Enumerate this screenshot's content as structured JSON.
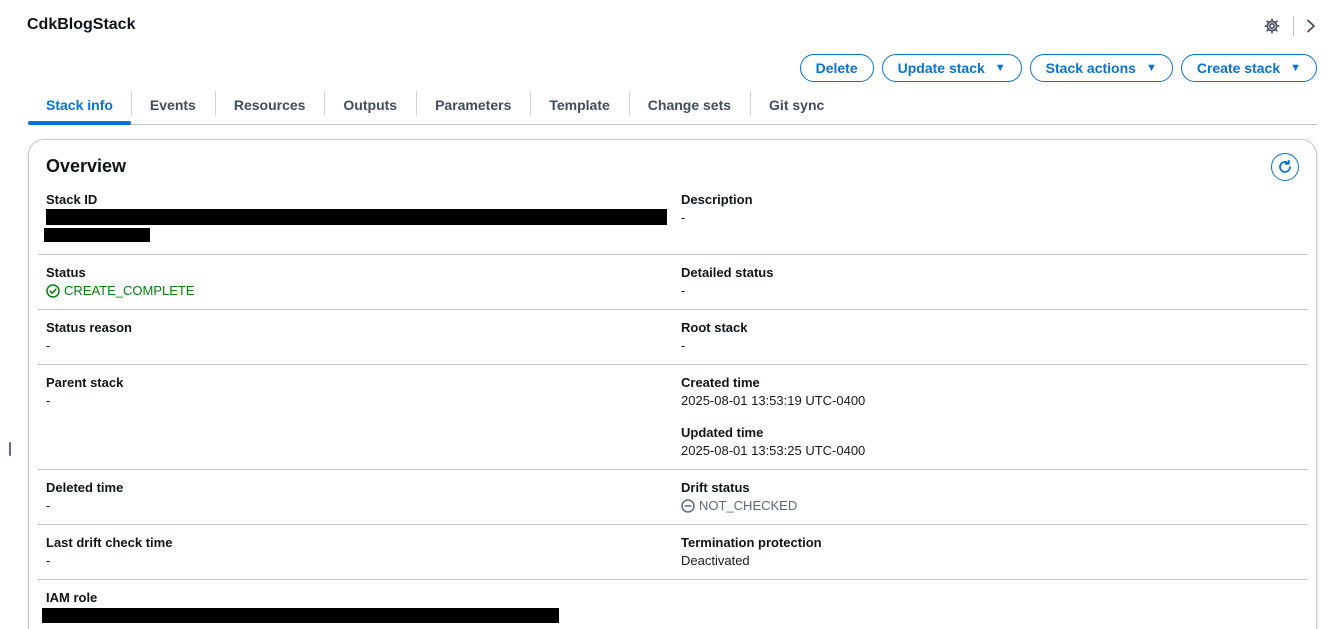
{
  "stack": {
    "title": "CdkBlogStack"
  },
  "header": {
    "settings_icon": "gear-icon",
    "collapse_icon": "chevron-right-icon"
  },
  "actions": [
    {
      "label": "Delete",
      "dropdown": false
    },
    {
      "label": "Update stack",
      "dropdown": true
    },
    {
      "label": "Stack actions",
      "dropdown": true
    },
    {
      "label": "Create stack",
      "dropdown": true
    }
  ],
  "tabs": [
    {
      "label": "Stack info",
      "active": true
    },
    {
      "label": "Events",
      "active": false
    },
    {
      "label": "Resources",
      "active": false
    },
    {
      "label": "Outputs",
      "active": false
    },
    {
      "label": "Parameters",
      "active": false
    },
    {
      "label": "Template",
      "active": false
    },
    {
      "label": "Change sets",
      "active": false
    },
    {
      "label": "Git sync",
      "active": false
    }
  ],
  "overview": {
    "title": "Overview",
    "stack_id": {
      "label": "Stack ID",
      "value": ""
    },
    "description": {
      "label": "Description",
      "value": "-"
    },
    "status": {
      "label": "Status",
      "value": "CREATE_COMPLETE"
    },
    "detailed_status": {
      "label": "Detailed status",
      "value": "-"
    },
    "status_reason": {
      "label": "Status reason",
      "value": "-"
    },
    "root_stack": {
      "label": "Root stack",
      "value": "-"
    },
    "parent_stack": {
      "label": "Parent stack",
      "value": "-"
    },
    "created_time": {
      "label": "Created time",
      "value": "2025-08-01 13:53:19 UTC-0400"
    },
    "updated_time": {
      "label": "Updated time",
      "value": "2025-08-01 13:53:25 UTC-0400"
    },
    "deleted_time": {
      "label": "Deleted time",
      "value": "-"
    },
    "drift_status": {
      "label": "Drift status",
      "value": "NOT_CHECKED"
    },
    "last_drift_check": {
      "label": "Last drift check time",
      "value": "-"
    },
    "termination_protection": {
      "label": "Termination protection",
      "value": "Deactivated"
    },
    "iam_role": {
      "label": "IAM role",
      "value": ""
    }
  },
  "colors": {
    "accent": "#0972d3",
    "success": "#037f0c",
    "muted": "#5f6b7a",
    "border": "#c6c6cd"
  }
}
